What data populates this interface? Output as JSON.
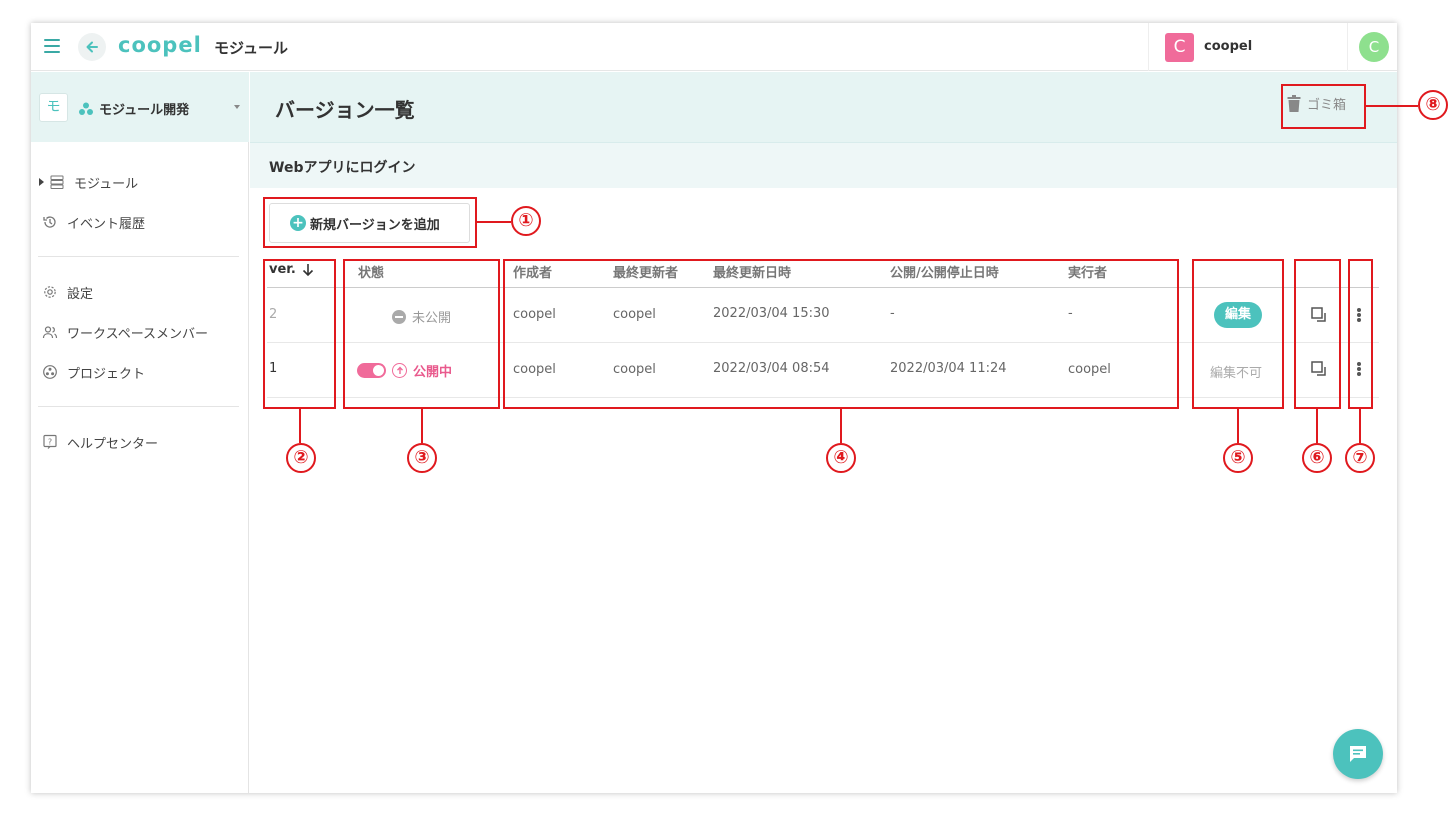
{
  "topbar": {
    "logo": "coopel",
    "title": "モジュール",
    "workspace_initial": "C",
    "workspace_name": "coopel",
    "avatar_initial": "C",
    "accent_color": "#4cc2bd",
    "user_color": "#f06b9a"
  },
  "sidebar": {
    "project_icon_text": "モ",
    "project_name": "モジュール開発",
    "items": [
      {
        "label": "モジュール",
        "icon": "module-list-icon"
      },
      {
        "label": "イベント履歴",
        "icon": "history-icon"
      },
      {
        "label": "設定",
        "icon": "gear-icon"
      },
      {
        "label": "ワークスペースメンバー",
        "icon": "members-icon"
      },
      {
        "label": "プロジェクト",
        "icon": "project-icon"
      },
      {
        "label": "ヘルプセンター",
        "icon": "help-icon"
      }
    ]
  },
  "page": {
    "title": "バージョン一覧",
    "trash_label": "ゴミ箱",
    "module_name": "Webアプリにログイン",
    "add_button_label": "新規バージョンを追加"
  },
  "table": {
    "headers": {
      "ver": "ver.",
      "status": "状態",
      "creator": "作成者",
      "updater": "最終更新者",
      "updated_at": "最終更新日時",
      "published_at": "公開/公開停止日時",
      "executor": "実行者"
    },
    "rows": [
      {
        "ver": "2",
        "status": "未公開",
        "creator": "coopel",
        "updater": "coopel",
        "updated_at": "2022/03/04 15:30",
        "published_at": "-",
        "executor": "-",
        "edit": "編集"
      },
      {
        "ver": "1",
        "status": "公開中",
        "creator": "coopel",
        "updater": "coopel",
        "updated_at": "2022/03/04 08:54",
        "published_at": "2022/03/04 11:24",
        "executor": "coopel",
        "edit": "編集不可"
      }
    ]
  },
  "annotations": [
    "①",
    "②",
    "③",
    "④",
    "⑤",
    "⑥",
    "⑦",
    "⑧"
  ]
}
